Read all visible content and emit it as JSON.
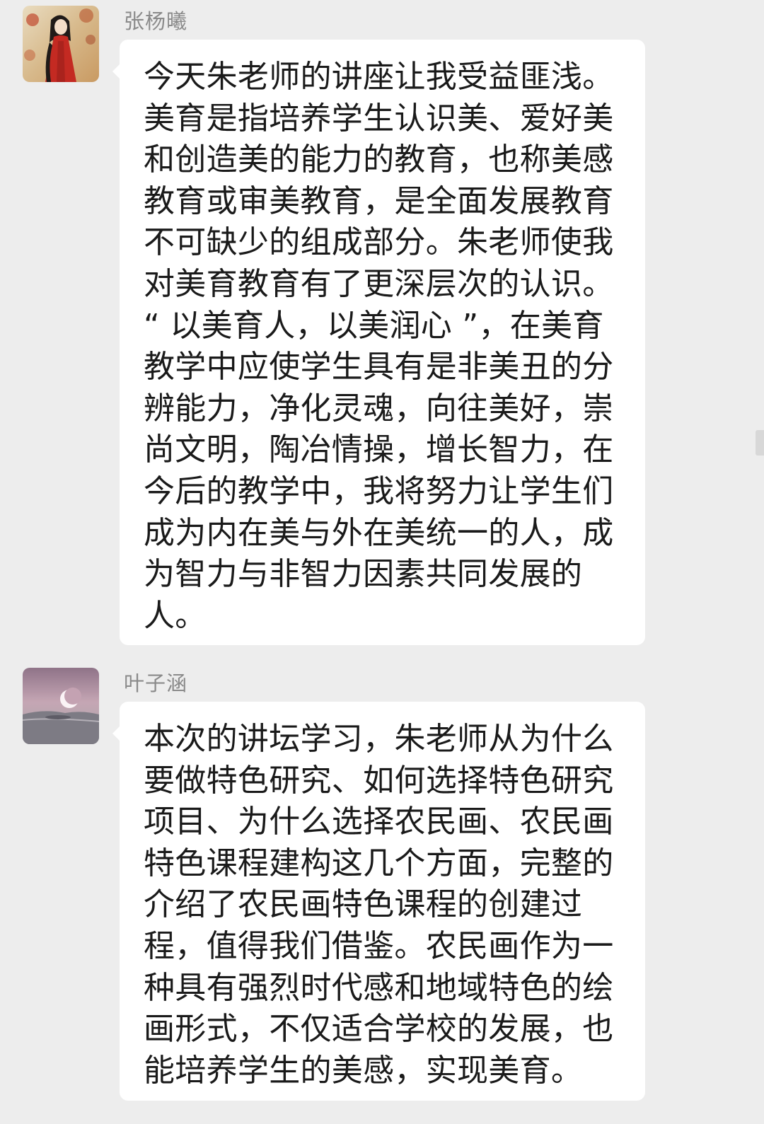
{
  "messages": [
    {
      "sender": "张杨曦",
      "avatar_icon": "avatar-girl-in-red-icon",
      "text": "今天朱老师的讲座让我受益匪浅。\n美育是指培养学生认识美、爱好美\n和创造美的能力的教育，也称美感\n教育或审美教育，是全面发展教育\n不可缺少的组成部分。朱老师使我\n对美育教育有了更深层次的认识。\n“ 以美育人，以美润心 ”，在美育\n教学中应使学生具有是非美丑的分\n辨能力，净化灵魂，向往美好，崇\n尚文明，陶冶情操，增长智力，在\n今后的教学中，我将努力让学生们\n成为内在美与外在美统一的人，成\n为智力与非智力因素共同发展的\n人。"
    },
    {
      "sender": "叶子涵",
      "avatar_icon": "avatar-moon-landscape-icon",
      "text": "本次的讲坛学习，朱老师从为什么\n要做特色研究、如何选择特色研究\n项目、为什么选择农民画、农民画\n特色课程建构这几个方面，完整的\n介绍了农民画特色课程的创建过\n程，值得我们借鉴。农民画作为一\n种具有强烈时代感和地域特色的绘\n画形式，不仅适合学校的发展，也\n能培养学生的美感，实现美育。"
    }
  ],
  "colors": {
    "background": "#ededed",
    "bubble": "#ffffff",
    "sender_name": "#8a8a8a",
    "message_text": "#1a1a1a"
  }
}
